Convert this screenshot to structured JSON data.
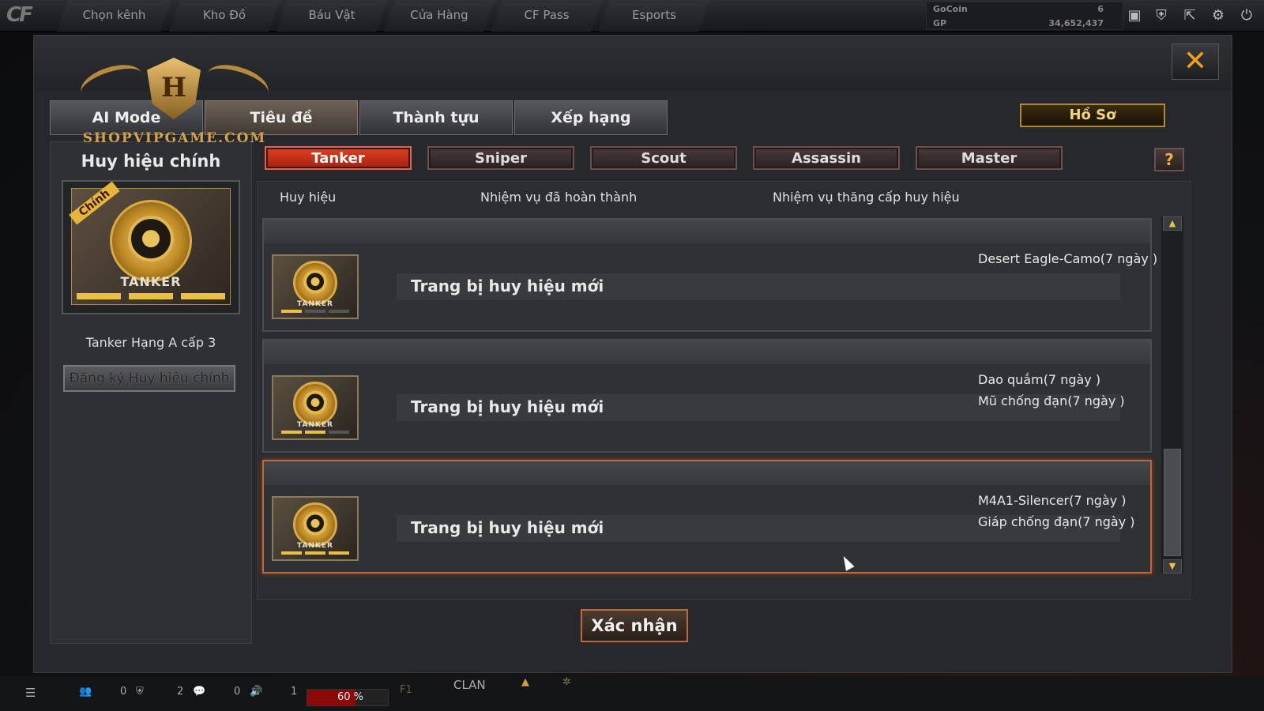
{
  "topnav": {
    "tabs": [
      "Chọn kênh",
      "Kho Đồ",
      "Báu Vật",
      "Cửa Hàng",
      "CF Pass",
      "Esports"
    ]
  },
  "currency": {
    "gocoin_label": "GoCoin",
    "gocoin_value": "6",
    "gp_label": "GP",
    "gp_value": "34,652,437"
  },
  "brand": {
    "letter": "H",
    "text": "SHOPVIPGAME.COM"
  },
  "main_tabs": [
    "AI Mode",
    "Tiêu đề",
    "Thành tựu",
    "Xếp hạng"
  ],
  "main_tabs_active": "Tiêu đề",
  "profile_button": "Hồ Sơ",
  "left_panel": {
    "title": "Huy hiệu chính",
    "ribbon": "Chính",
    "badge_label": "TANKER",
    "subtitle": "Tanker Hạng A cấp 3",
    "button": "Đăng ký Huy hiệu chính"
  },
  "class_tabs": [
    "Tanker",
    "Sniper",
    "Scout",
    "Assassin",
    "Master"
  ],
  "class_tabs_active": "Tanker",
  "help_label": "?",
  "list": {
    "headers": [
      "Huy hiệu",
      "Nhiệm vụ đã hoàn thành",
      "Nhiệm vụ thăng cấp huy hiệu"
    ],
    "rows": [
      {
        "badge": "TANKER",
        "level_filled": 1,
        "mission": "Trang bị huy hiệu mới",
        "rewards": [
          "Desert Eagle-Camo(7 ngày )"
        ]
      },
      {
        "badge": "TANKER",
        "level_filled": 2,
        "mission": "Trang bị huy hiệu mới",
        "rewards": [
          "Dao quắm(7 ngày )",
          "Mũ chống đạn(7 ngày )"
        ]
      },
      {
        "badge": "TANKER",
        "level_filled": 3,
        "mission": "Trang bị huy hiệu mới",
        "rewards": [
          "M4A1-Silencer(7 ngày )",
          "Giáp chống đạn(7 ngày )"
        ],
        "selected": true
      }
    ]
  },
  "confirm_button": "Xác nhận",
  "bottom": {
    "counts": [
      "0",
      "2",
      "0",
      "1"
    ],
    "progress_text": "60 %",
    "progress_value": 0.6,
    "f1": "F1",
    "clan": "CLAN"
  },
  "colors": {
    "accent": "#e04020",
    "gold": "#e9c040",
    "selected_border": "#c0683a"
  }
}
